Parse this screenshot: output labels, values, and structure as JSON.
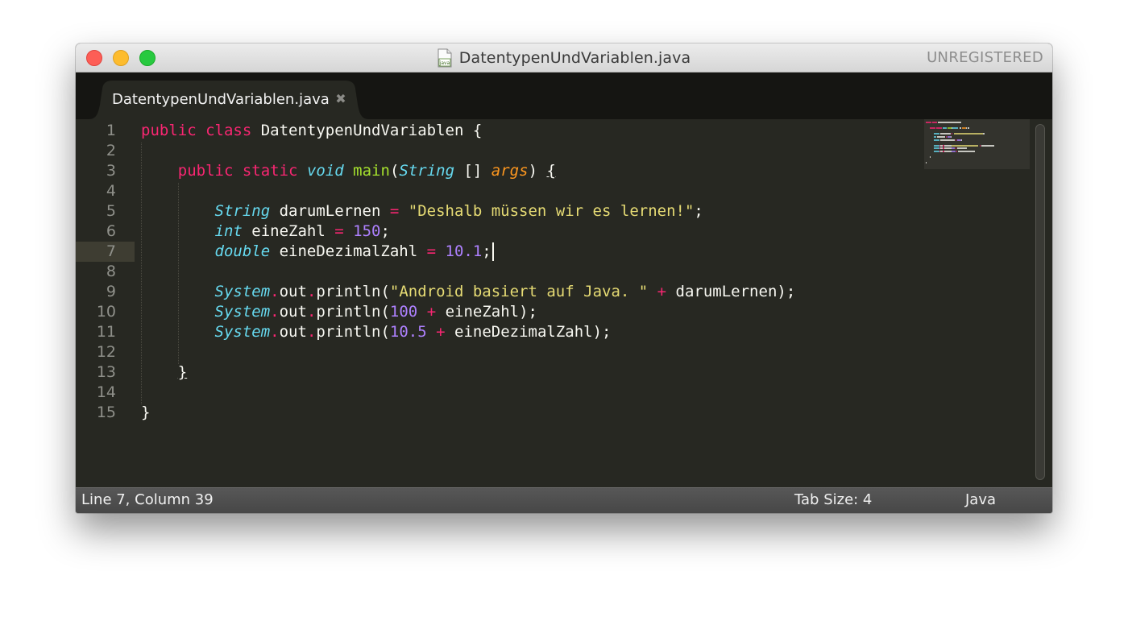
{
  "window": {
    "title": "DatentypenUndVariablen.java",
    "file_icon": "java-file-icon",
    "file_icon_text": "java",
    "registration_status": "UNREGISTERED",
    "traffic_lights": {
      "close": "#fd5e56",
      "minimize": "#fdbc2e",
      "maximize": "#27c93f"
    }
  },
  "tabs": [
    {
      "label": "DatentypenUndVariablen.java",
      "close_glyph": "✖",
      "active": true
    }
  ],
  "editor": {
    "theme_colors": {
      "background": "#272822",
      "keyword": "#f92672",
      "type": "#66d9ef",
      "function": "#a6e22e",
      "string": "#e6db74",
      "number": "#ae81ff",
      "argument": "#fd971f",
      "text": "#f8f8f2",
      "line_number": "#8f908a"
    },
    "current_line": 7,
    "lines": [
      {
        "n": "1",
        "tokens": [
          [
            "kw",
            "public"
          ],
          [
            "pl",
            " "
          ],
          [
            "kw",
            "class"
          ],
          [
            "pl",
            " DatentypenUndVariablen {"
          ]
        ]
      },
      {
        "n": "2",
        "tokens": []
      },
      {
        "n": "3",
        "tokens": [
          [
            "pl",
            "    "
          ],
          [
            "kw",
            "public"
          ],
          [
            "pl",
            " "
          ],
          [
            "kw",
            "static"
          ],
          [
            "pl",
            " "
          ],
          [
            "st",
            "void"
          ],
          [
            "pl",
            " "
          ],
          [
            "fn",
            "main"
          ],
          [
            "pl",
            "("
          ],
          [
            "ty",
            "String"
          ],
          [
            "pl",
            " [] "
          ],
          [
            "ar",
            "args"
          ],
          [
            "pl",
            ") "
          ],
          [
            "uline",
            "{"
          ]
        ]
      },
      {
        "n": "4",
        "tokens": []
      },
      {
        "n": "5",
        "tokens": [
          [
            "pl",
            "        "
          ],
          [
            "ty",
            "String"
          ],
          [
            "pl",
            " darumLernen "
          ],
          [
            "op",
            "="
          ],
          [
            "pl",
            " "
          ],
          [
            "str",
            "\"Deshalb müssen wir es lernen!\""
          ],
          [
            "pl",
            ";"
          ]
        ]
      },
      {
        "n": "6",
        "tokens": [
          [
            "pl",
            "        "
          ],
          [
            "ty",
            "int"
          ],
          [
            "pl",
            " eineZahl "
          ],
          [
            "op",
            "="
          ],
          [
            "pl",
            " "
          ],
          [
            "num",
            "150"
          ],
          [
            "pl",
            ";"
          ]
        ]
      },
      {
        "n": "7",
        "tokens": [
          [
            "pl",
            "        "
          ],
          [
            "ty",
            "double"
          ],
          [
            "pl",
            " eineDezimalZahl "
          ],
          [
            "op",
            "="
          ],
          [
            "pl",
            " "
          ],
          [
            "num",
            "10.1"
          ],
          [
            "pl",
            ";"
          ]
        ]
      },
      {
        "n": "8",
        "tokens": []
      },
      {
        "n": "9",
        "tokens": [
          [
            "pl",
            "        "
          ],
          [
            "ty",
            "System"
          ],
          [
            "op",
            "."
          ],
          [
            "pl",
            "out"
          ],
          [
            "op",
            "."
          ],
          [
            "pl",
            "println("
          ],
          [
            "str",
            "\"Android basiert auf Java. \""
          ],
          [
            "pl",
            " "
          ],
          [
            "op",
            "+"
          ],
          [
            "pl",
            " darumLernen);"
          ]
        ]
      },
      {
        "n": "10",
        "tokens": [
          [
            "pl",
            "        "
          ],
          [
            "ty",
            "System"
          ],
          [
            "op",
            "."
          ],
          [
            "pl",
            "out"
          ],
          [
            "op",
            "."
          ],
          [
            "pl",
            "println("
          ],
          [
            "num",
            "100"
          ],
          [
            "pl",
            " "
          ],
          [
            "op",
            "+"
          ],
          [
            "pl",
            " eineZahl);"
          ]
        ]
      },
      {
        "n": "11",
        "tokens": [
          [
            "pl",
            "        "
          ],
          [
            "ty",
            "System"
          ],
          [
            "op",
            "."
          ],
          [
            "pl",
            "out"
          ],
          [
            "op",
            "."
          ],
          [
            "pl",
            "println("
          ],
          [
            "num",
            "10.5"
          ],
          [
            "pl",
            " "
          ],
          [
            "op",
            "+"
          ],
          [
            "pl",
            " eineDezimalZahl);"
          ]
        ]
      },
      {
        "n": "12",
        "tokens": []
      },
      {
        "n": "13",
        "tokens": [
          [
            "pl",
            "    "
          ],
          [
            "uline",
            "}"
          ]
        ]
      },
      {
        "n": "14",
        "tokens": []
      },
      {
        "n": "15",
        "tokens": [
          [
            "pl",
            "}"
          ]
        ]
      }
    ]
  },
  "statusbar": {
    "position": "Line 7, Column 39",
    "tab_size": "Tab Size: 4",
    "syntax": "Java"
  }
}
